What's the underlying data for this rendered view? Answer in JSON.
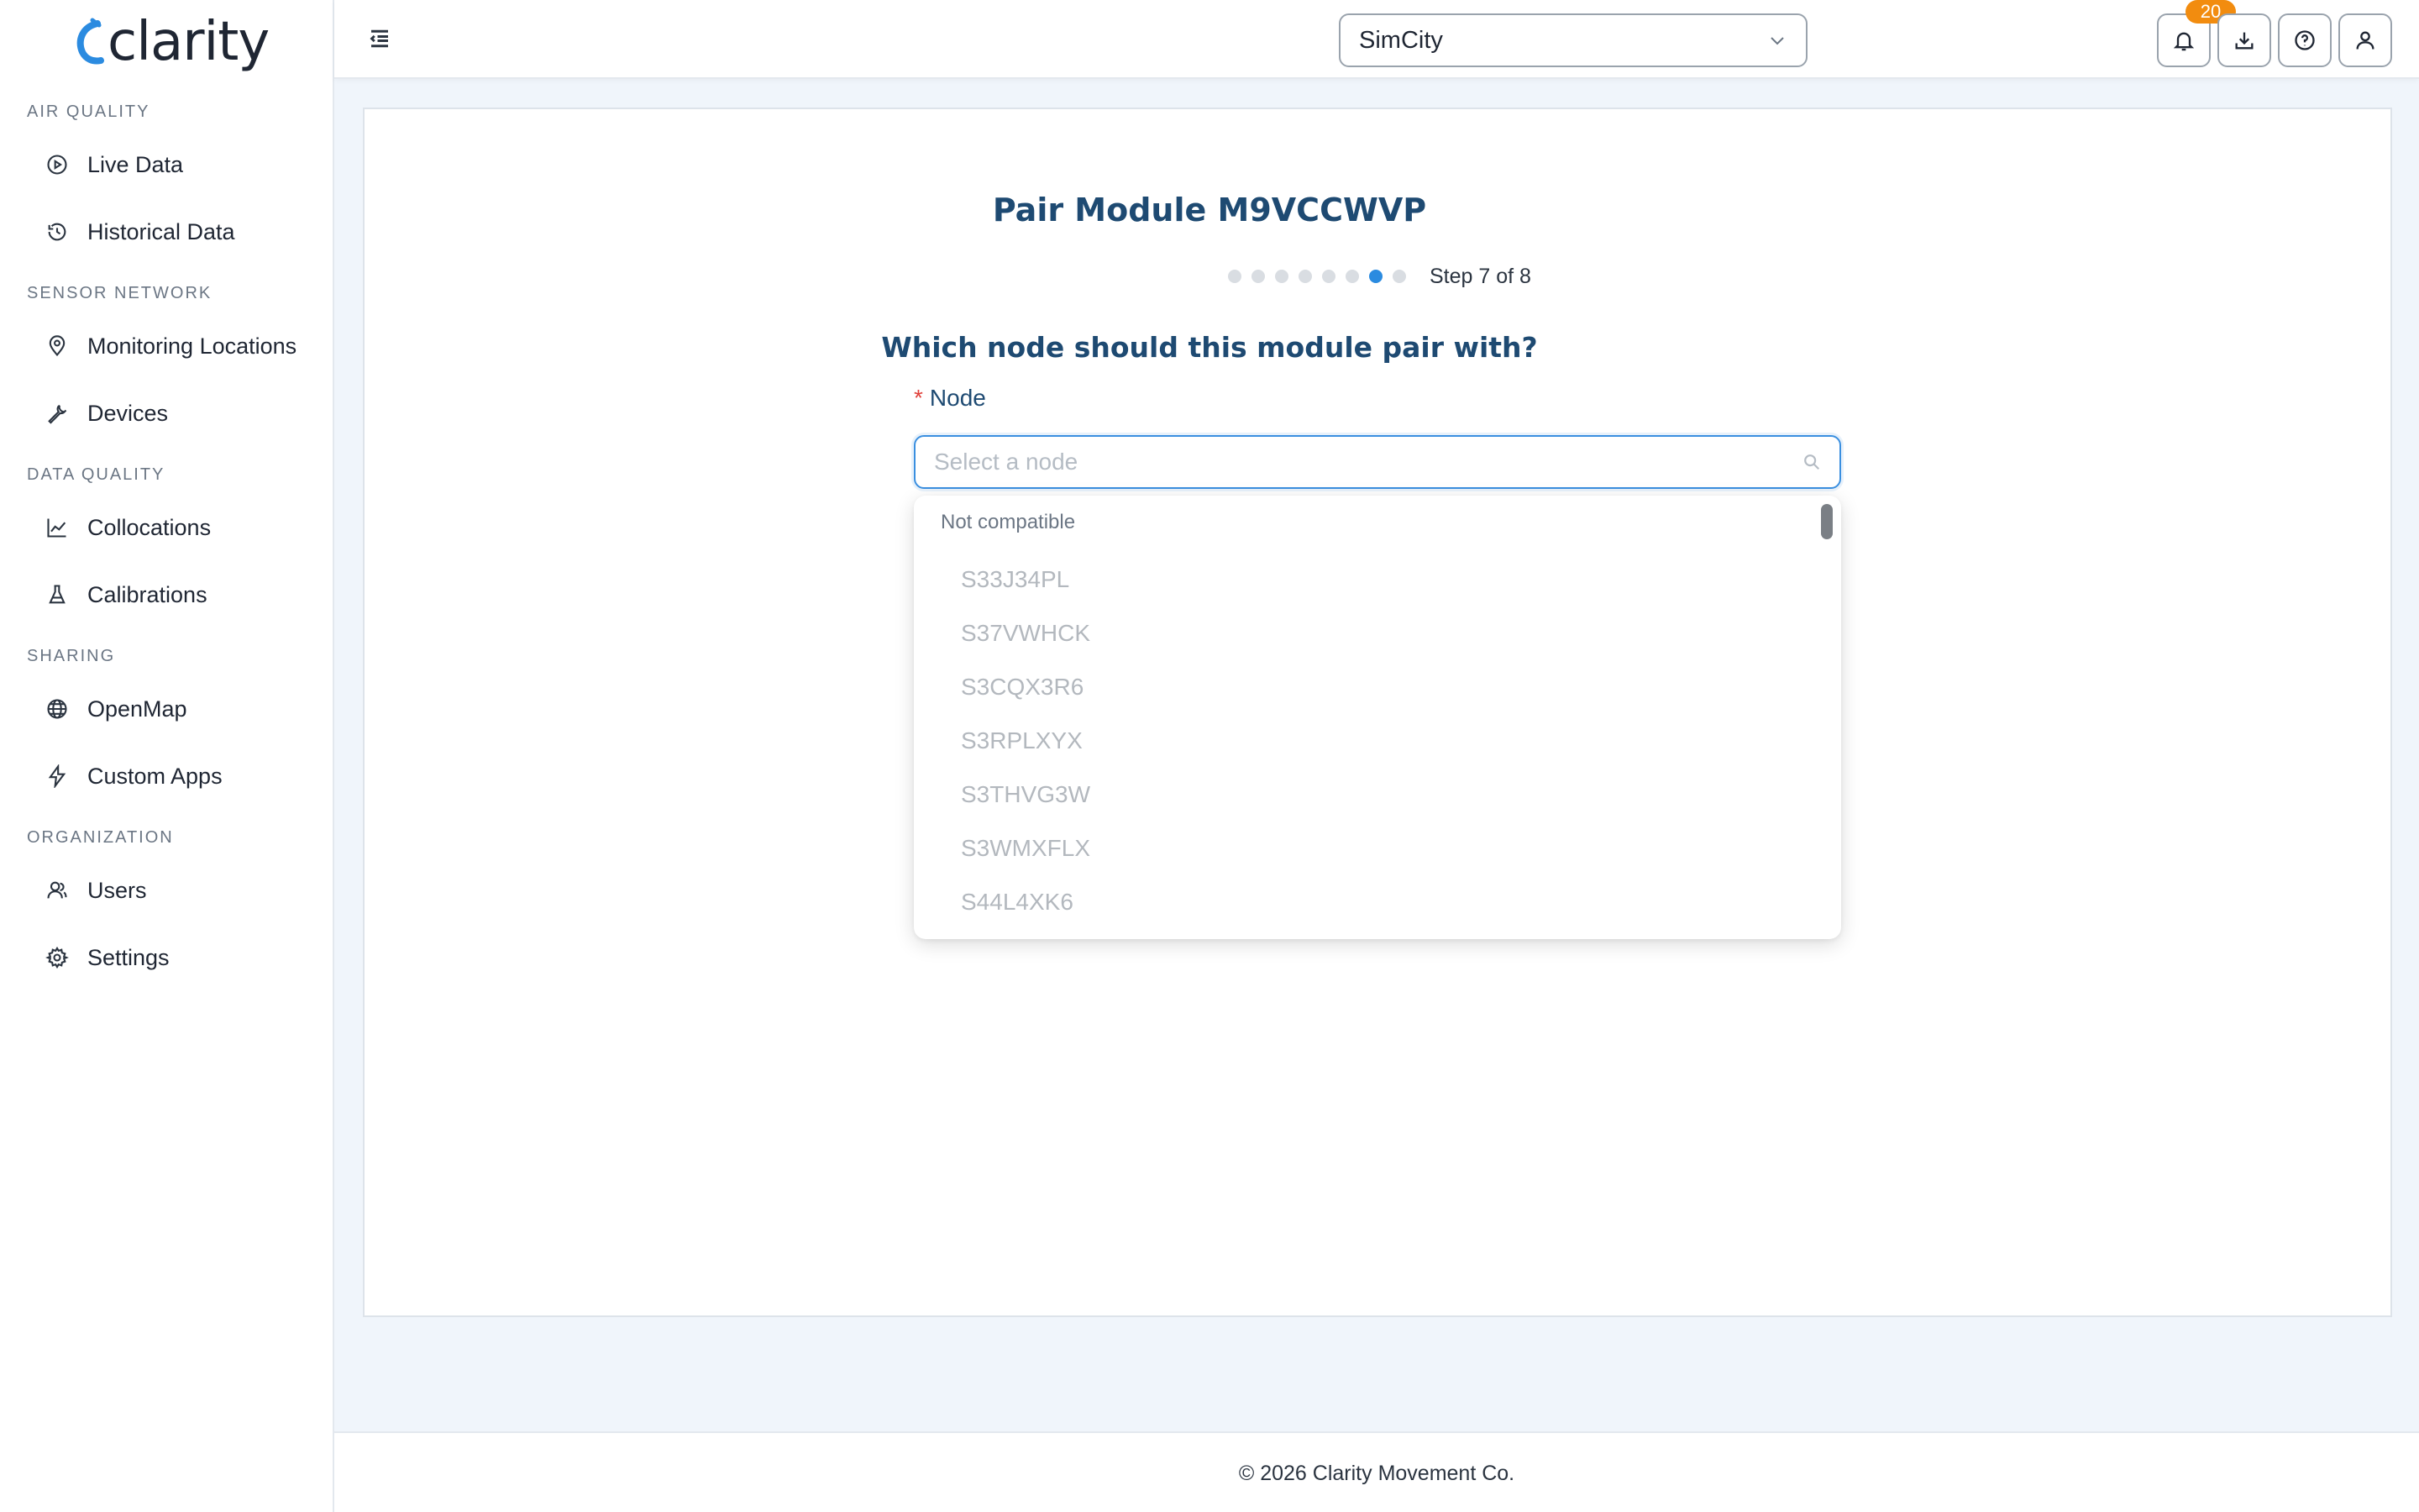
{
  "brand": {
    "name": "clarity",
    "accent": "#2b8be0"
  },
  "sidebar": {
    "sections": [
      {
        "title": "AIR QUALITY"
      },
      {
        "title": "SENSOR NETWORK"
      },
      {
        "title": "DATA QUALITY"
      },
      {
        "title": "SHARING"
      },
      {
        "title": "ORGANIZATION"
      }
    ],
    "items": [
      {
        "label": "Live Data",
        "icon": "play-circle-icon"
      },
      {
        "label": "Historical Data",
        "icon": "history-icon"
      },
      {
        "label": "Monitoring Locations",
        "icon": "location-pin-icon"
      },
      {
        "label": "Devices",
        "icon": "wrench-icon"
      },
      {
        "label": "Collocations",
        "icon": "line-chart-icon"
      },
      {
        "label": "Calibrations",
        "icon": "flask-icon"
      },
      {
        "label": "OpenMap",
        "icon": "globe-icon"
      },
      {
        "label": "Custom Apps",
        "icon": "lightning-icon"
      },
      {
        "label": "Users",
        "icon": "users-icon"
      },
      {
        "label": "Settings",
        "icon": "gear-icon"
      }
    ]
  },
  "header": {
    "org_select_value": "SimCity",
    "notification_count": "20",
    "buttons": [
      "bell-icon",
      "download-icon",
      "help-icon",
      "user-icon"
    ]
  },
  "wizard": {
    "title": "Pair Module M9VCCWVP",
    "total_steps": 8,
    "current_step": 7,
    "step_label": "Step 7 of 8",
    "question": "Which node should this module pair with?",
    "field_required_mark": "*",
    "field_label": "Node",
    "input_placeholder": "Select a node",
    "input_value": ""
  },
  "dropdown": {
    "group_label": "Not compatible",
    "options": [
      "S33J34PL",
      "S37VWHCK",
      "S3CQX3R6",
      "S3RPLXYX",
      "S3THVG3W",
      "S3WMXFLX",
      "S44L4XK6"
    ]
  },
  "footer": {
    "text": "© 2026 Clarity Movement Co."
  }
}
